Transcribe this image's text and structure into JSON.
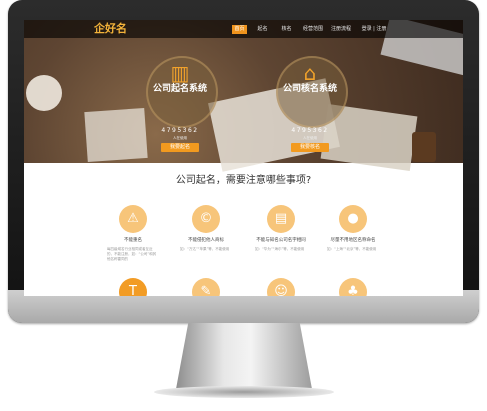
{
  "site": {
    "logo": "企好名"
  },
  "nav": [
    "首页",
    "起名",
    "核名",
    "经营范围",
    "注册流程",
    "登录 | 注册"
  ],
  "systems": [
    {
      "title": "公司起名系统",
      "count": "4795362",
      "count_label": "人在使用",
      "button": "我要起名",
      "icon": "city-skyline-icon"
    },
    {
      "title": "公司核名系统",
      "count": "4795362",
      "count_label": "人在使用",
      "button": "我要核名",
      "icon": "government-building-icon"
    }
  ],
  "question": "公司起名，需要注意哪些事项?",
  "features": [
    {
      "title": "不能重名",
      "desc": "每四级域名行业相同或者互近的，不能注册，如：“公司”和其他名称雷同的",
      "icon": "warning-icon"
    },
    {
      "title": "不能侵犯他人商标",
      "desc": "如：“万达”“苹果”等，不能使用",
      "icon": "copyright-icon"
    },
    {
      "title": "不能与知名公司名字相同",
      "desc": "如：“华为”“海尔”等，不能使用",
      "icon": "document-icon"
    },
    {
      "title": "尽量不用地区名称命名",
      "desc": "如：“上海”“北京”等，不能使用",
      "icon": "location-pin-icon"
    },
    {
      "title": "",
      "desc": "",
      "icon": "text-icon"
    },
    {
      "title": "",
      "desc": "",
      "icon": "tag-icon"
    },
    {
      "title": "",
      "desc": "",
      "icon": "person-icon"
    },
    {
      "title": "",
      "desc": "",
      "icon": "bell-icon"
    }
  ]
}
